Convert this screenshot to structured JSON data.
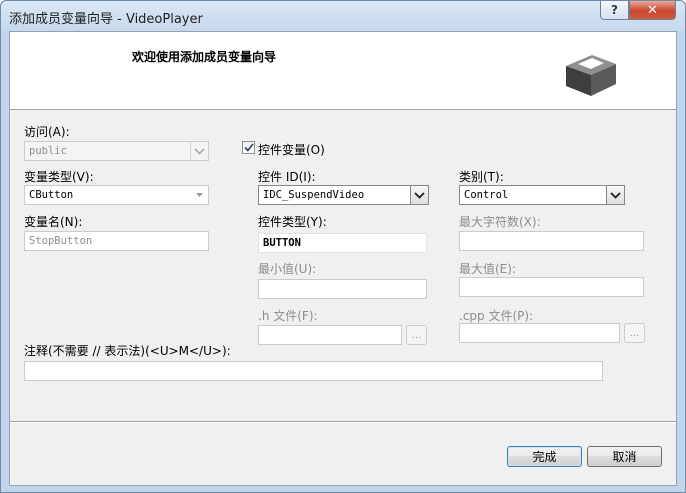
{
  "window": {
    "title": "添加成员变量向导 - VideoPlayer",
    "help_glyph": "?",
    "close_glyph": "✕"
  },
  "header": {
    "title": "欢迎使用添加成员变量向导",
    "icon": "class-box-icon"
  },
  "form": {
    "access": {
      "label": "访问(A):",
      "value": "public"
    },
    "var_type": {
      "label": "变量类型(V):",
      "value": "CButton"
    },
    "var_name": {
      "label": "变量名(N):",
      "value": "StopButton"
    },
    "control_var": {
      "label": "控件变量(O)",
      "checked": true
    },
    "control_id": {
      "label": "控件 ID(I):",
      "value": "IDC_SuspendVideo"
    },
    "category": {
      "label": "类别(T):",
      "value": "Control"
    },
    "control_type": {
      "label": "控件类型(Y):",
      "value": "BUTTON"
    },
    "max_chars": {
      "label": "最大字符数(X):",
      "value": ""
    },
    "min_value": {
      "label": "最小值(U):",
      "value": ""
    },
    "max_value": {
      "label": "最大值(E):",
      "value": ""
    },
    "h_file": {
      "label": ".h 文件(F):",
      "value": "",
      "browse": "..."
    },
    "cpp_file": {
      "label": ".cpp 文件(P):",
      "value": "",
      "browse": "..."
    },
    "comment": {
      "label": "注释(不需要 // 表示法)(<U>M</U>):",
      "value": ""
    }
  },
  "buttons": {
    "finish": "完成",
    "cancel": "取消"
  },
  "colors": {
    "frame": "#c2d5ea",
    "client": "#f0f0f0",
    "close_button": "#c8462f",
    "disabled_text": "#8d8d8d"
  }
}
